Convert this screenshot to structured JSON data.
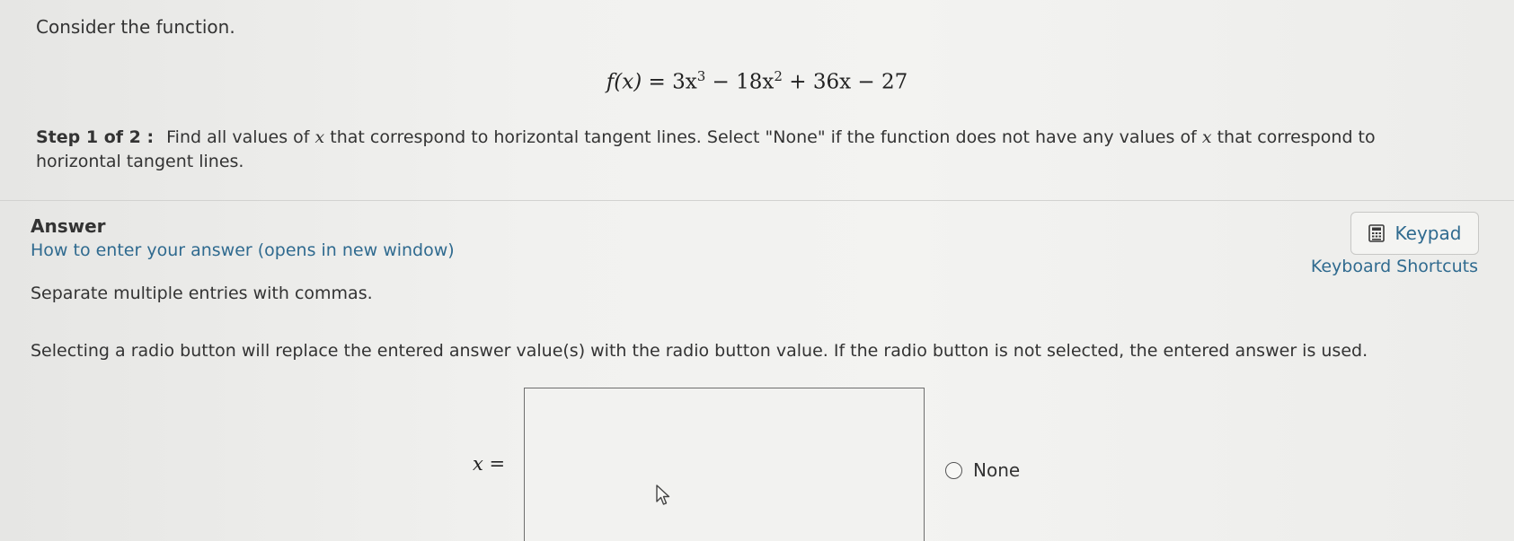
{
  "question": {
    "intro": "Consider the function.",
    "formula": {
      "lhs": "f(x)",
      "rhs_part1": " = 3x",
      "exp1": "3",
      "rhs_part2": " − 18x",
      "exp2": "2",
      "rhs_part3": " + 36x − 27"
    },
    "step_label": "Step 1 of 2 :",
    "step_text_1": "Find all values of",
    "step_var_1": "x",
    "step_text_2": "that correspond to horizontal tangent lines. Select \"None\" if the function does not have any values of",
    "step_var_2": "x",
    "step_text_3": "that correspond to horizontal tangent lines."
  },
  "answer": {
    "heading": "Answer",
    "how_to_link": "How to enter your answer (opens in new window)",
    "keypad_label": "Keypad",
    "keypad_icon": "calculator-icon",
    "shortcuts_link": "Keyboard Shortcuts",
    "separate_note": "Separate multiple entries with commas.",
    "radio_note": "Selecting a radio button will replace the entered answer value(s) with the radio button value. If the radio button is not selected, the entered answer is used.",
    "input_label_var": "x",
    "input_label_eq": " =",
    "input_value": "",
    "none_option_label": "None",
    "none_selected": false
  },
  "colors": {
    "link": "#2f6a8f",
    "text": "#333333",
    "background": "#f1f1ef"
  }
}
